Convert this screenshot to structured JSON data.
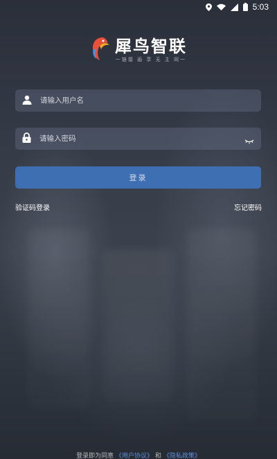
{
  "status_bar": {
    "time": "5:03",
    "icons": [
      "location-icon",
      "wifi-icon",
      "signal-icon",
      "battery-icon"
    ]
  },
  "logo": {
    "title": "犀鸟智联",
    "subtitle": "一链接 画 享 无 主 同一"
  },
  "form": {
    "username_placeholder": "请输入用户名",
    "password_placeholder": "请输入密码",
    "login_label": "登录"
  },
  "links": {
    "sms_login": "验证码登录",
    "forgot_password": "忘记密码"
  },
  "footer": {
    "prefix": "登录即为同意",
    "user_agreement": "《用户协议》",
    "and": "和",
    "privacy_policy": "《隐私政策》"
  },
  "colors": {
    "accent": "#3f6fb3",
    "field_bg": "#4b5266",
    "link": "#5f8fd6"
  }
}
